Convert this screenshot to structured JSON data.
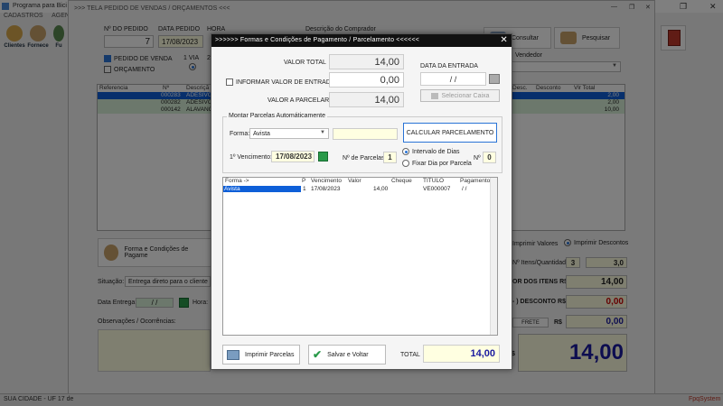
{
  "app": {
    "title": "Programa para Bici",
    "menu": [
      "CADASTROS",
      "AGEND"
    ],
    "toolbar": [
      {
        "label": "Clientes",
        "icon": "clients-icon"
      },
      {
        "label": "Fornece",
        "icon": "supplier-icon"
      },
      {
        "label": "Fu",
        "icon": "employee-icon"
      }
    ],
    "statusbar_left": "SUA CIDADE - UF 17 de",
    "statusbar_right": "FpqSystem"
  },
  "main": {
    "caption": ">>>  TELA PEDIDO DE VENDAS / ORÇAMENTOS  <<<",
    "n_pedido_label": "Nº DO PEDIDO",
    "n_pedido_value": "7",
    "data_pedido_label": "DATA PEDIDO",
    "data_pedido_value": "17/08/2023",
    "hora_label": "HORA",
    "pedido_venda_label": "PEDIDO DE VENDA",
    "orcamento_label": "ORÇAMENTO",
    "via_label": "1 VIA",
    "via2_label": "2",
    "descricao_comprador_label": "Descrição do Comprador",
    "consultar_label": "Consultar",
    "pesquisar_label": "Pesquisar",
    "vendedor_label": "Vendedor",
    "grid_headers": [
      "Referencia",
      "Nº",
      "Descriçã",
      "Desc.",
      "Desconto",
      "Vlr Total"
    ],
    "grid_rows": [
      {
        "n": "000283",
        "desc": "ADESIVO",
        "total": "2,00"
      },
      {
        "n": "000282",
        "desc": "ADESIVO",
        "total": "2,00"
      },
      {
        "n": "000142",
        "desc": "ALAVANC",
        "total": "10,00"
      }
    ],
    "forma_btn_label": "Forma e Condições de Pagame",
    "situacao_label": "Situação:",
    "situacao_value": "Entrega direto para o cliente",
    "data_entrega_label": "Data Entrega:",
    "data_entrega_value": "/ /",
    "hora_entrega_label": "Hora:",
    "obs_label": "Observações / Ocorrências:",
    "imprimir_valores_label": "Imprimir Valores",
    "imprimir_descontos_label": "Imprimir Descontos",
    "itens_qtd_label": "Nº Itens/Quantidade",
    "itens_value": "3",
    "qtd_value": "3,0",
    "valor_itens_label": "OR DOS ITENS R$",
    "valor_itens_value": "14,00",
    "desconto_label": "- ) DESCONTO R$",
    "desconto_value": "0,00",
    "frete_label": "FRETE",
    "frete_rs_label": "R$",
    "frete_value": "0,00",
    "total_rs_label": "$",
    "total_value": "14,00"
  },
  "modal": {
    "title": ">>>>>> Formas e Condições de Pagamento / Parcelamento  <<<<<<",
    "valor_total_label": "VALOR TOTAL",
    "valor_total_value": "14,00",
    "informar_entrada_label": "INFORMAR VALOR DE ENTRADA",
    "valor_entrada_value": "0,00",
    "valor_parcelar_label": "VALOR A PARCELAR",
    "valor_parcelar_value": "14,00",
    "data_entrada_label": "DATA DA ENTRADA",
    "data_entrada_value": "/   /",
    "selecionar_caixa_label": "Selecionar Caixa",
    "montar_group_label": "Montar Parcelas Automáticamente",
    "forma_label": "Forma:",
    "forma_value": "Avista",
    "calcular_label": "CALCULAR  PARCELAMENTO",
    "vencimento_label": "1º Vencimento:",
    "vencimento_value": "17/08/2023",
    "n_parcelas_label": "Nº de Parcelas",
    "n_parcelas_value": "1",
    "intervalo_label": "Intervalo de Dias",
    "fixar_label": "Fixar Dia por Parcela",
    "n_label": "Nº",
    "n_value": "0",
    "grid_headers": [
      "Forma ->",
      "P",
      "Vencimento",
      "Valor",
      "Cheque",
      "TITULO",
      "Pagamento ->"
    ],
    "grid_row": {
      "forma": "Avista",
      "p": "1",
      "vencimento": "17/08/2023",
      "valor": "14,00",
      "cheque": "",
      "titulo": "VE000007",
      "pagamento": "/ /"
    },
    "imprimir_parcelas_label": "Imprimir Parcelas",
    "salvar_voltar_label": "Salvar e Voltar",
    "total_label": "TOTAL",
    "total_value": "14,00"
  },
  "colors": {
    "modal_title_bg": "#111111",
    "selection_blue": "#0e5fd8",
    "highlight_yellow": "#ffffe1",
    "total_blue": "#1a1aa0",
    "discount_red": "#cc0000"
  }
}
